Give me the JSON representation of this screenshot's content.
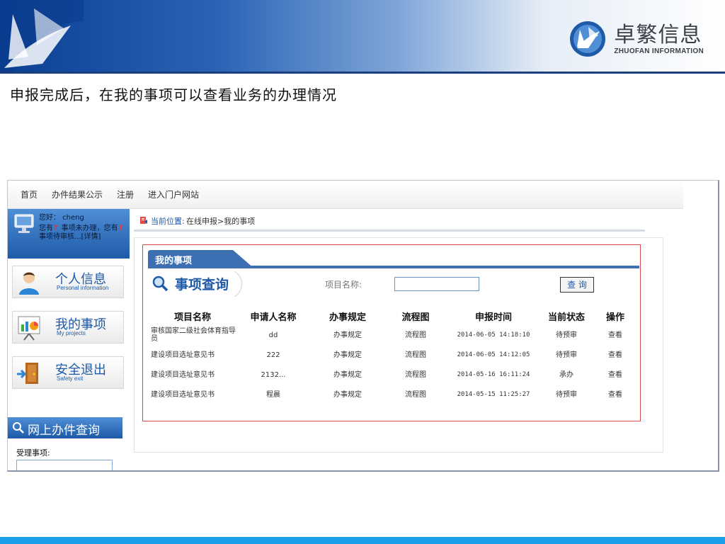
{
  "brand": {
    "cn": "卓繁信息",
    "en": "ZHUOFAN INFORMATION"
  },
  "caption": "申报完成后，在我的事项可以查看业务的办理情况",
  "topnav": [
    "首页",
    "办件结果公示",
    "注册",
    "进入门户网站"
  ],
  "user": {
    "greeting": "您好： cheng",
    "msg_a": "您有",
    "msg_b": "事项未办理，您有",
    "msg_c": "事项待审核...",
    "detail": "[详情]"
  },
  "menu": [
    {
      "title": "个人信息",
      "subtitle": "Personal information",
      "icon": "person-icon"
    },
    {
      "title": "我的事项",
      "subtitle": "My projects",
      "icon": "chart-board-icon"
    },
    {
      "title": "安全退出",
      "subtitle": "Safety exit",
      "icon": "exit-door-icon"
    }
  ],
  "online_search": {
    "title": "网上办件查询",
    "accept_label": "受理事项:"
  },
  "breadcrumb": {
    "label": "当前位置:",
    "path": "在线申报>我的事项"
  },
  "tab": {
    "label": "我的事项"
  },
  "query": {
    "title": "事项查询",
    "field_label": "项目名称:",
    "button": "查 询",
    "input_value": ""
  },
  "table": {
    "headers": [
      "项目名称",
      "申请人名称",
      "办事规定",
      "流程图",
      "申报时间",
      "当前状态",
      "操作"
    ],
    "rows": [
      [
        "审核国家二级社会体育指导员",
        "dd",
        "办事规定",
        "流程图",
        "2014-06-05 14:18:10",
        "待预审",
        "查看"
      ],
      [
        "建设项目选址意见书",
        "222",
        "办事规定",
        "流程图",
        "2014-06-05 14:12:05",
        "待预审",
        "查看"
      ],
      [
        "建设项目选址意见书",
        "2132...",
        "办事规定",
        "流程图",
        "2014-05-16 16:11:24",
        "承办",
        "查看"
      ],
      [
        "建设项目选址意见书",
        "程晨",
        "办事规定",
        "流程图",
        "2014-05-15 11:25:27",
        "待预审",
        "查看"
      ]
    ]
  },
  "colors": {
    "accent": "#1e5aa8",
    "highlight_border": "#e24a4a",
    "footer": "#1aa0e8"
  }
}
